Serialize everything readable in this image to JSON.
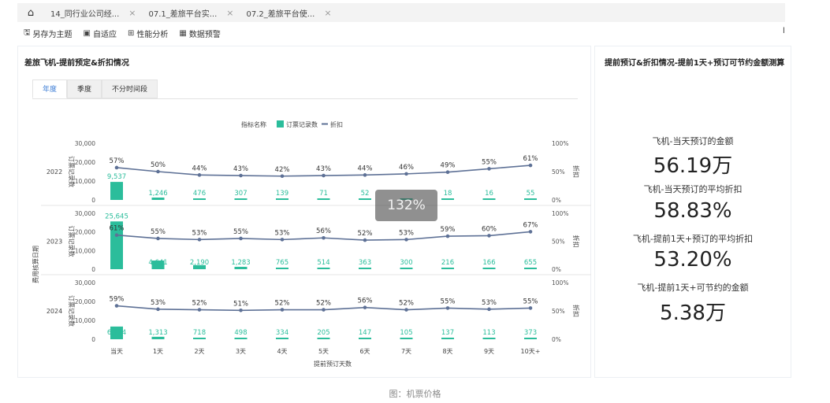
{
  "tabbar": {
    "home_icon": "home-icon",
    "tabs": [
      {
        "label": "14_同行业公司经..."
      },
      {
        "label": "07.1_差旅平台实..."
      },
      {
        "label": "07.2_差旅平台使..."
      }
    ],
    "close_glyph": "×"
  },
  "toolbar": {
    "items": [
      {
        "label": "另存为主题",
        "icon": "save-icon"
      },
      {
        "label": "自适应",
        "icon": "fit-icon"
      },
      {
        "label": "性能分析",
        "icon": "performance-icon"
      },
      {
        "label": "数据预警",
        "icon": "alert-icon"
      }
    ],
    "edge_text": "l"
  },
  "left_panel": {
    "title": "差旅飞机-提前预定&折扣情况",
    "tabs": [
      "年度",
      "季度",
      "不分时间段"
    ],
    "active_tab": 0
  },
  "right_panel": {
    "title": "提前预订&折扣情况-提前1天+预订可节约金额测算",
    "metrics": [
      {
        "label": "飞机-当天预订的金额",
        "value": "56.19万"
      },
      {
        "label": "飞机-当天预订的平均折扣",
        "value": "58.83%"
      },
      {
        "label": "飞机-提前1天+预订的平均折扣",
        "value": "53.20%"
      },
      {
        "label": "飞机-提前1天+可节约的金额",
        "value": "5.38万"
      }
    ]
  },
  "zoom_overlay": "132%",
  "caption": "图：机票价格",
  "colors": {
    "bar": "#2bbd9b",
    "line": "#5e7196",
    "accent": "#3a7bd5"
  },
  "chart_data": {
    "type": "bar",
    "legend_title": "指标名称",
    "legend": [
      "订票记录数",
      "折扣"
    ],
    "categories": [
      "当天",
      "1天",
      "2天",
      "3天",
      "4天",
      "5天",
      "6天",
      "7天",
      "8天",
      "9天",
      "10天+"
    ],
    "xlabel": "提前预订天数",
    "ylabel_outer": "费用核算日期",
    "ylabel_left": "订票记录数",
    "ylabel_right": "折扣",
    "ylim_left": [
      0,
      30000
    ],
    "left_ticks": [
      "30,000",
      "20,000",
      "10,000",
      "0"
    ],
    "right_ticks": [
      "100%",
      "50%",
      "0%"
    ],
    "rows": [
      {
        "year": "2022",
        "bookings": [
          9537,
          1246,
          476,
          307,
          139,
          71,
          52,
          42,
          18,
          16,
          55
        ],
        "booking_labels": [
          "9,537",
          "1,246",
          "476",
          "307",
          "139",
          "71",
          "52",
          "",
          "18",
          "16",
          "55"
        ],
        "discount": [
          57,
          50,
          44,
          43,
          42,
          43,
          44,
          46,
          49,
          55,
          61
        ]
      },
      {
        "year": "2023",
        "bookings": [
          25645,
          4641,
          2190,
          1283,
          765,
          514,
          363,
          300,
          216,
          166,
          655
        ],
        "booking_labels": [
          "25,645",
          "4,641",
          "2,190",
          "1,283",
          "765",
          "514",
          "363",
          "300",
          "216",
          "166",
          "655"
        ],
        "discount": [
          61,
          55,
          53,
          55,
          53,
          56,
          52,
          53,
          59,
          60,
          67
        ]
      },
      {
        "year": "2024",
        "bookings": [
          6724,
          1313,
          718,
          498,
          334,
          205,
          147,
          105,
          137,
          113,
          373
        ],
        "booking_labels": [
          "6,724",
          "1,313",
          "718",
          "498",
          "334",
          "205",
          "147",
          "105",
          "137",
          "113",
          "373"
        ],
        "discount": [
          59,
          53,
          52,
          51,
          52,
          52,
          56,
          52,
          55,
          53,
          55
        ]
      }
    ]
  }
}
